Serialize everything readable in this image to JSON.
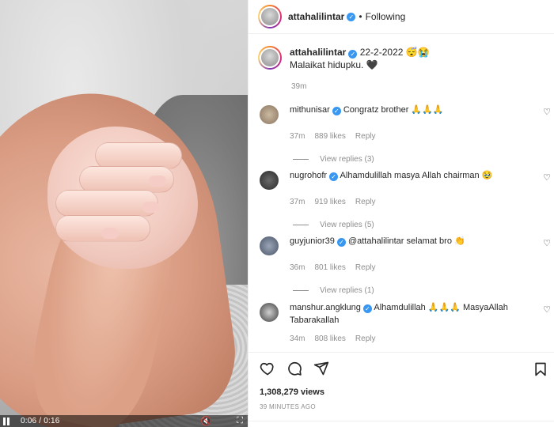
{
  "post": {
    "username": "attahalilintar",
    "follow_status": "Following",
    "separator": "•"
  },
  "video": {
    "time": "0:06 / 0:16",
    "volume_icon": "volume-muted-icon",
    "fullscreen_icon": "fullscreen-icon"
  },
  "caption": {
    "username": "attahalilintar",
    "date": "22-2-2022",
    "emoji": "😴😭",
    "text": "Malaikat hidupku. 🖤",
    "age": "39m"
  },
  "comments": [
    {
      "username": "mithunisar",
      "text": "Congratz brother 🙏🙏🙏",
      "age": "37m",
      "likes": "889 likes",
      "reply": "Reply",
      "replies": "View replies (3)"
    },
    {
      "username": "nugrohofr",
      "text": "Alhamdulillah masya Allah chairman 🥹",
      "age": "37m",
      "likes": "919 likes",
      "reply": "Reply",
      "replies": "View replies (5)"
    },
    {
      "username": "guyjunior39",
      "text": "@attahalilintar selamat bro 👏",
      "age": "36m",
      "likes": "801 likes",
      "reply": "Reply",
      "replies": "View replies (1)"
    },
    {
      "username": "manshur.angklung",
      "text": "Alhamdulillah 🙏🙏🙏 MasyaAllah Tabarakallah",
      "age": "34m",
      "likes": "808 likes",
      "reply": "Reply",
      "replies": ""
    }
  ],
  "stats": {
    "views": "1,308,279 views",
    "posted": "39 MINUTES AGO"
  },
  "icons": [
    "heart-icon",
    "comment-icon",
    "share-icon",
    "bookmark-icon"
  ],
  "colors": {
    "verified": "#3897f0",
    "muted": "#8e8e8e",
    "text": "#262626"
  }
}
